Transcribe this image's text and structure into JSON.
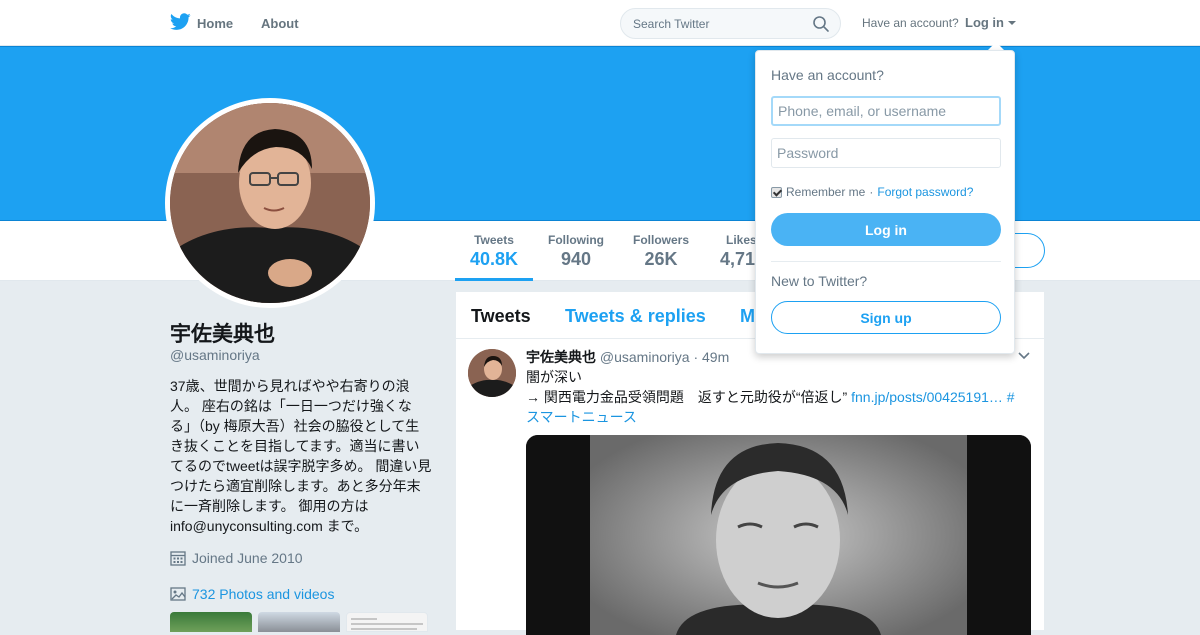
{
  "topbar": {
    "home_label": "Home",
    "about_label": "About",
    "search_placeholder": "Search Twitter",
    "have_account": "Have an account?",
    "login_label": "Log in",
    "icons": [
      "twitter-bird-icon",
      "search-icon",
      "caret-down-icon"
    ]
  },
  "colors": {
    "brand": "#1da1f2",
    "text": "#14171a",
    "muted": "#657786",
    "link": "#1b95e0",
    "background": "#e6ecf0"
  },
  "stats": [
    {
      "label": "Tweets",
      "value": "40.8K",
      "active": true
    },
    {
      "label": "Following",
      "value": "940"
    },
    {
      "label": "Followers",
      "value": "26K"
    },
    {
      "label": "Likes",
      "value": "4,71"
    }
  ],
  "profile": {
    "name": "宇佐美典也",
    "handle": "@usaminoriya",
    "bio": "37歳、世間から見ればやや右寄りの浪人。 座右の銘は「一日一つだけ強くなる」（by 梅原大吾）社会の脇役として生き抜くことを目指してます。適当に書いてるのでtweetは誤字脱字多め。 間違い見つけたら適宜削除します。あと多分年末に一斉削除します。 御用の方は info@unyconsulting.com まで。",
    "joined": "Joined June 2010",
    "photos": "732 Photos and videos"
  },
  "timeline": {
    "tabs": [
      "Tweets",
      "Tweets & replies",
      "M"
    ]
  },
  "tweet": {
    "name": "宇佐美典也",
    "meta": "@usaminoriya · 49m",
    "line1": "闇が深い",
    "line2": "→ 関西電力金品受領問題　返すと元助役が“倍返し” ",
    "link": "fnn.jp/posts/00425191…",
    "hashtag_hash": " #",
    "hashtag": "スマートニュース"
  },
  "login_dropdown": {
    "title": "Have an account?",
    "username_placeholder": "Phone, email, or username",
    "password_placeholder": "Password",
    "remember": "Remember me",
    "separator": " · ",
    "forgot": "Forgot password?",
    "login_button": "Log in",
    "new_to": "New to Twitter?",
    "signup_button": "Sign up"
  }
}
